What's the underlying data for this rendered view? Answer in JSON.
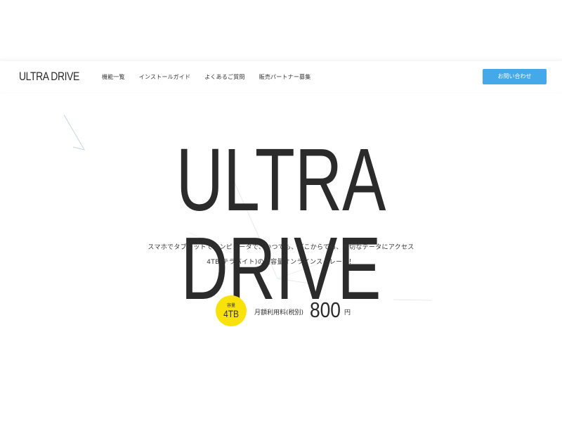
{
  "header": {
    "logo": "ULTRA DRIVE",
    "nav": [
      {
        "label": "機能一覧"
      },
      {
        "label": "インストールガイド"
      },
      {
        "label": "よくあるご質問"
      },
      {
        "label": "販売パートナー募集"
      }
    ],
    "contact_label": "お問い合わせ"
  },
  "hero": {
    "title": "ULTRA DRIVE",
    "description_line1": "スマホでタブレットでコンピュータで、いつでも、どこからでも、大切なデータにアクセス",
    "description_line2": "4TB(テラバイト)の大容量オンラインストレージ！"
  },
  "pricing": {
    "capacity_label": "容量",
    "capacity_value": "4TB",
    "price_label": "月額利用料(税別)",
    "price_value": "800",
    "price_unit": "円"
  },
  "colors": {
    "accent_button": "#45a8e8",
    "badge": "#f9e20a",
    "text": "#2b2b2b"
  }
}
